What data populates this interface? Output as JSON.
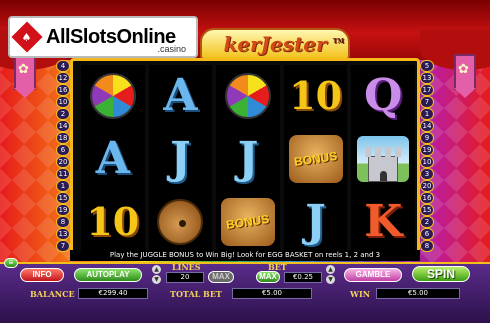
{
  "brand": {
    "logo_mark": "♠",
    "logo_text": "AllSlotsOnline",
    "logo_sub": ".casino"
  },
  "game": {
    "title": "kerJester",
    "title_tm": "TM"
  },
  "reels": [
    [
      "beachball",
      "A",
      "10"
    ],
    [
      "A",
      "J",
      "lute"
    ],
    [
      "beachball",
      "J",
      "bonus-basket"
    ],
    [
      "10",
      "bonus-barrel",
      "J"
    ],
    [
      "Q",
      "castle",
      "K"
    ]
  ],
  "bonus_text": "BONUS",
  "left_numbers": [
    "4",
    "12",
    "16",
    "10",
    "2",
    "14",
    "18",
    "6",
    "20",
    "11",
    "1",
    "15",
    "19",
    "8",
    "13",
    "7"
  ],
  "right_numbers": [
    "5",
    "13",
    "17",
    "7",
    "1",
    "14",
    "9",
    "19",
    "10",
    "3",
    "20",
    "16",
    "15",
    "2",
    "6",
    "8"
  ],
  "info_message": "Play the JUGGLE BONUS to Win Big! Look for EGG BASKET on reels 1, 2 and 3",
  "controls": {
    "info": "INFO",
    "autoplay": "AUTOPLAY",
    "lines_label": "LINES",
    "lines_value": "20",
    "lines_max": "MAX",
    "bet_label": "BET",
    "bet_max": "MAX",
    "bet_value": "€0.25",
    "gamble": "GAMBLE",
    "spin": "SPIN",
    "balance_label": "BALANCE",
    "balance_value": "€299.40",
    "total_bet_label": "TOTAL BET",
    "total_bet_value": "€5.00",
    "win_label": "WIN",
    "win_value": "€5.00",
    "arrow_up": "▲",
    "arrow_down": "▼",
    "menu_tab": "≡"
  },
  "colors": {
    "frame": "#f6b91a",
    "panel": "#3d1a66",
    "label": "#f4d35a"
  }
}
